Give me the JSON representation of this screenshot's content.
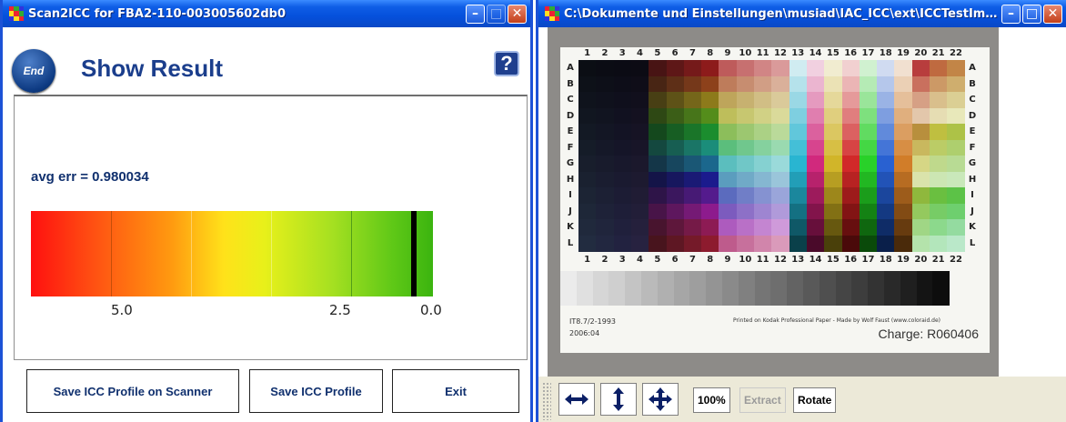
{
  "win1": {
    "title": "Scan2ICC for FBA2-110-003005602db0",
    "end_label": "End",
    "page_title": "Show Result",
    "help_label": "?",
    "avg_err": "avg err = 0.980034",
    "ticks": [
      "5.0",
      "2.5",
      "0.0"
    ],
    "buttons": {
      "save_scanner": "Save ICC Profile on Scanner",
      "save": "Save ICC Profile",
      "exit": "Exit"
    }
  },
  "win2": {
    "title": "C:\\Dokumente und Einstellungen\\musiad\\IAC_ICC\\ext\\ICCTestIm…",
    "rows": [
      "A",
      "B",
      "C",
      "D",
      "E",
      "F",
      "G",
      "H",
      "I",
      "J",
      "K",
      "L"
    ],
    "cols": [
      "1",
      "2",
      "3",
      "4",
      "5",
      "6",
      "7",
      "8",
      "9",
      "10",
      "11",
      "12",
      "13",
      "14",
      "15",
      "16",
      "17",
      "18",
      "19",
      "20",
      "21",
      "22"
    ],
    "footer_left": "IT8.7/2-1993",
    "footer_date": "2006:04",
    "footer_center": "Printed on Kodak Professional Paper - Made by Wolf Faust (www.coloraid.de)",
    "charge": "Charge: R060406",
    "toolbar": {
      "zoom": "100%",
      "extract": "Extract",
      "rotate": "Rotate"
    }
  },
  "icons": {
    "app": "app-icon",
    "minimize": "minimize-icon",
    "maximize": "maximize-icon",
    "close": "close-icon",
    "help": "help-icon",
    "h-arrows": "horizontal-arrows-icon",
    "v-arrows": "vertical-arrows-icon",
    "move": "move-icon"
  },
  "colors": {
    "title_blue": "#0a4fd6",
    "heading": "#1b3e8c",
    "close_red": "#c3401a"
  }
}
